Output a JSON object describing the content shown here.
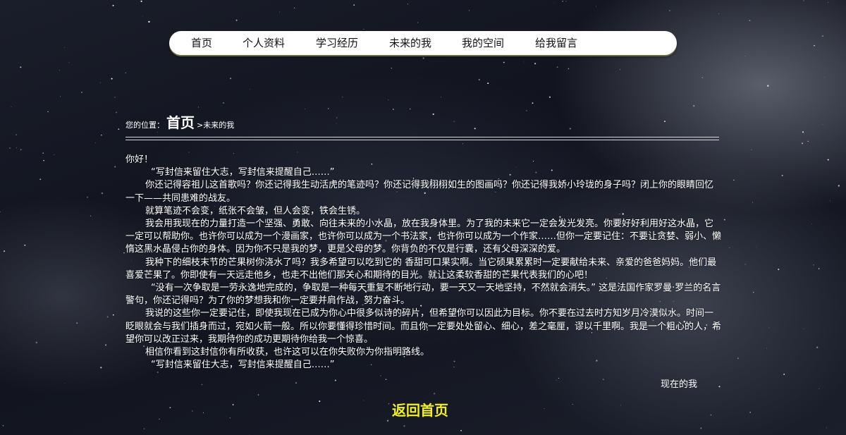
{
  "nav": {
    "items": [
      "首页",
      "个人资料",
      "学习经历",
      "未来的我",
      "我的空间",
      "给我留言"
    ]
  },
  "breadcrumb": {
    "prefix": "您的位置：",
    "home": "首页",
    "current": ">未来的我"
  },
  "letter": {
    "greeting": "你好！",
    "paragraphs": [
      "“写封信来留住大志，写封信来提醒自己……”",
      "你还记得容祖儿这首歌吗？你还记得我生动活虎的笔迹吗？你还记得我栩栩如生的图画吗？你还记得我娇小玲珑的身子吗？闭上你的眼睛回忆一下——共同患难的战友。",
      "就算笔迹不会变，纸张不会皱，但人会变，铁会生锈。",
      "我会用我现在的力量打造一个坚强、勇敢、向往未来的小水晶，放在我身体里。为了我的未来它一定会发光发亮。你要好好利用好这水晶，它一定可以帮助你。也许你可以成为一个漫画家，也许你可以成为一个书法家，也许你可以成为一个作家……但你一定要记住：不要让贪婪、弱小、懒惰这黑水晶侵占你的身体。因为你不只是我的梦，更是父母的梦。你背负的不仅是行囊，还有父母深深的爱。",
      "我种下的细枝末节的芒果树你浇水了吗？我多希望可以吃到它的 香甜可口果实啊。当它硕果累累时一定要献给未来、亲爱的爸爸妈妈。他们最喜爱芒果了。你即使有一天远走他乡，也走不出他们那关心和期待的目光。就让这柔软香甜的芒果代表我们的心吧！",
      "“没有一次争取是一劳永逸地完成的，争取是一种每天重复不断地行动，要一天又一天地坚持，不然就会消失。” 这是法国作家罗曼·罗兰的名言警句，你还记得吗？为了你的梦想我和你一定要并肩作战，努力奋斗。",
      "我说的这些你一定要记住，即使我现在已成为你心中很多似诗的碎片，但希望你可以因此为目标。你不要在过去时方知岁月冷漠似水。时间一眨眼就会与我们插身而过，宛如火箭一般。所以你要懂得珍惜时间。而且你一定要处处留心、细心，差之毫厘，谬以千里啊。我是一个粗心的人，希望你可以改正过来，我期待你的成功更期待你给我一个惊喜。",
      "相信你看到这封信你有所收获，也许这可以在你失败你为你指明路线。",
      "“写封信来留住大志，写封信来提醒自己……”"
    ],
    "signature": "现在的我"
  },
  "footer": {
    "back_home": "返回首页"
  },
  "colors": {
    "nav_bg": "#ffffff",
    "back_home": "#f2ef2a",
    "text": "#ffffff"
  }
}
